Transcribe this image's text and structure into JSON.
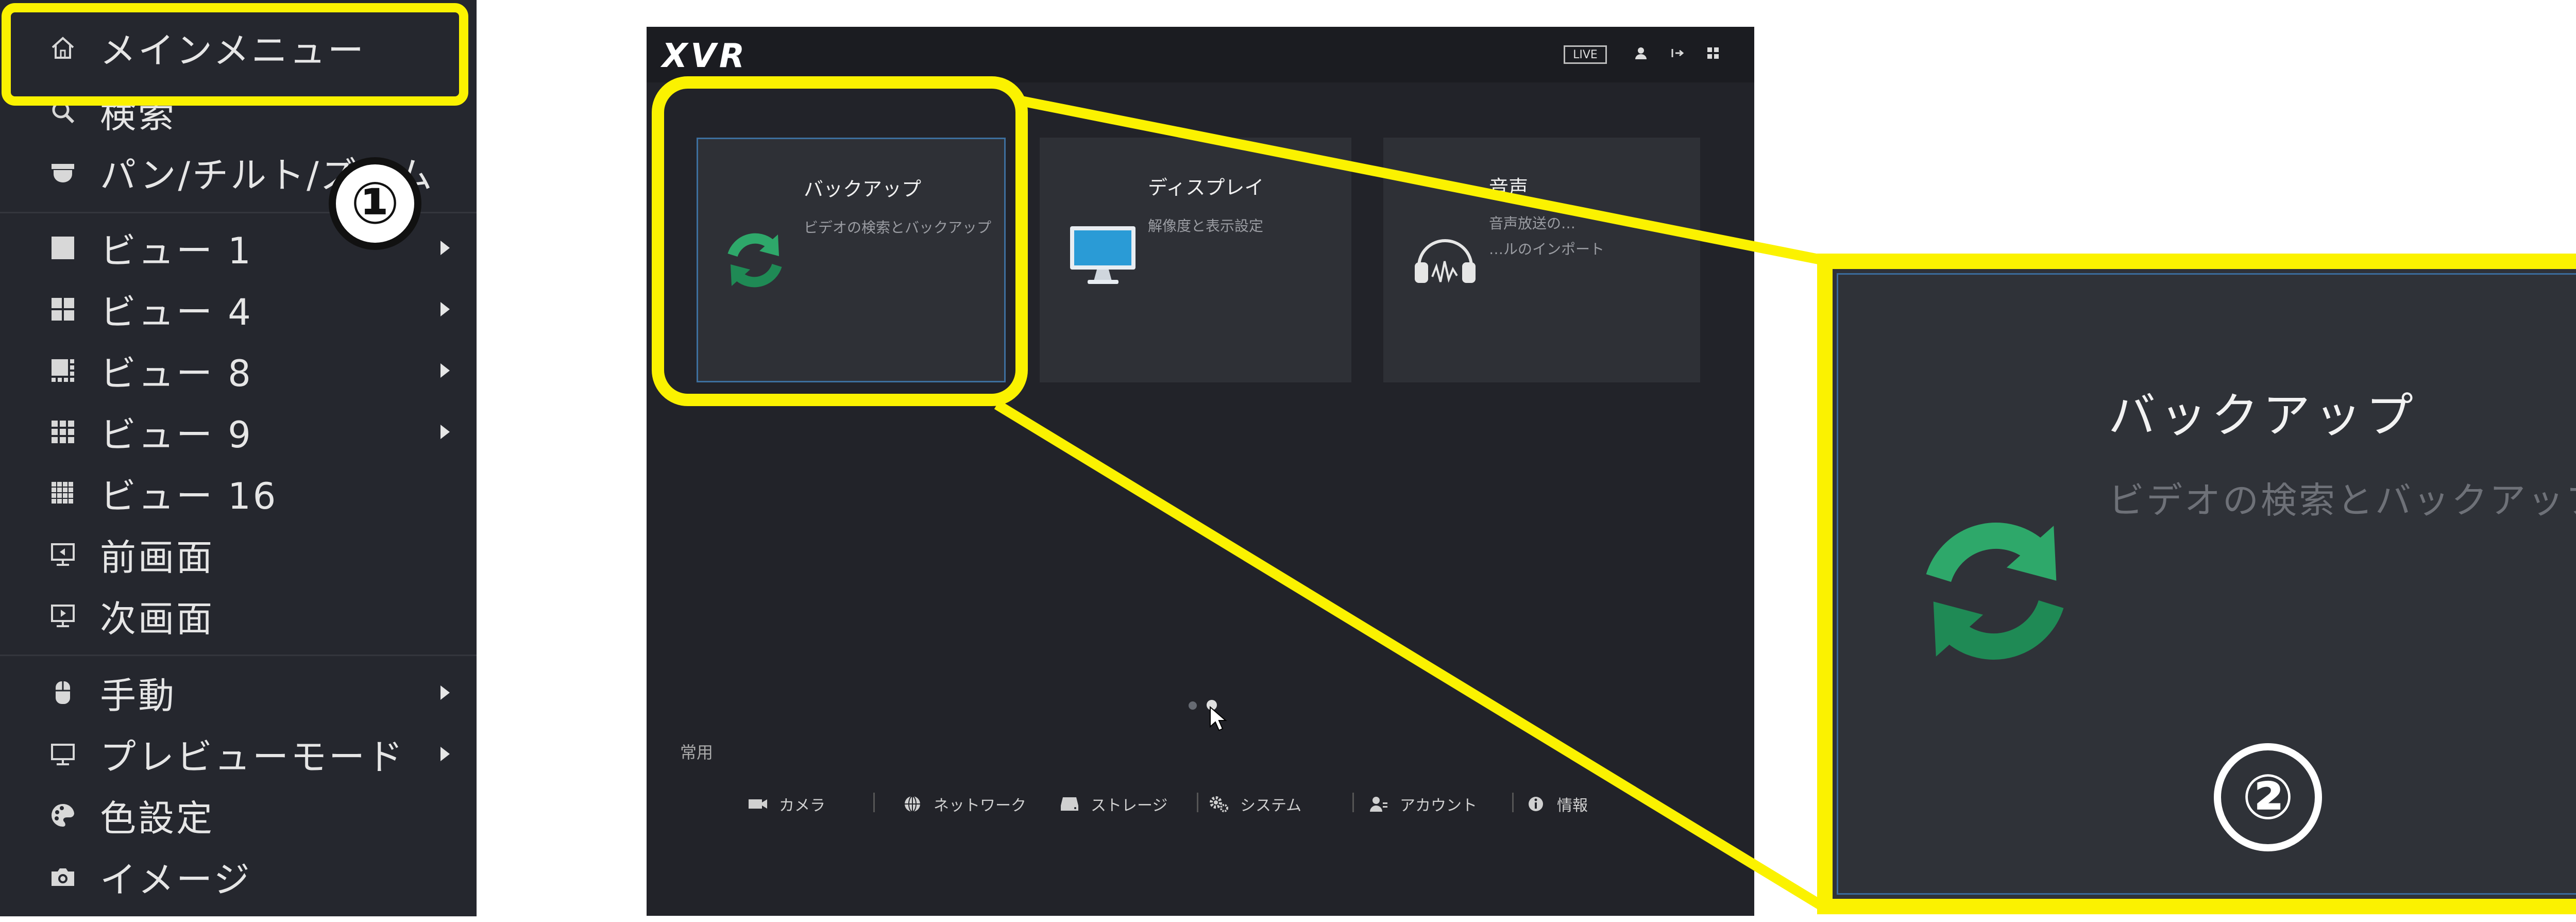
{
  "menu": {
    "items": [
      {
        "label": "メインメニュー",
        "icon": "home-icon",
        "arrow": false
      },
      {
        "label": "検索",
        "icon": "search-icon",
        "arrow": false
      },
      {
        "label": "パン/チルト/ズーム",
        "icon": "ptz-camera-icon",
        "arrow": false
      },
      {
        "label": "ビュー 1",
        "icon": "view-1-icon",
        "arrow": true
      },
      {
        "label": "ビュー 4",
        "icon": "view-4-icon",
        "arrow": true
      },
      {
        "label": "ビュー 8",
        "icon": "view-8-icon",
        "arrow": true
      },
      {
        "label": "ビュー 9",
        "icon": "view-9-icon",
        "arrow": true
      },
      {
        "label": "ビュー 16",
        "icon": "view-16-icon",
        "arrow": false
      },
      {
        "label": "前画面",
        "icon": "previous-screen-icon",
        "arrow": false
      },
      {
        "label": "次画面",
        "icon": "next-screen-icon",
        "arrow": false
      },
      {
        "label": "手動",
        "icon": "manual-icon",
        "arrow": true
      },
      {
        "label": "プレビューモード",
        "icon": "preview-mode-icon",
        "arrow": true
      },
      {
        "label": "色設定",
        "icon": "color-palette-icon",
        "arrow": false
      },
      {
        "label": "イメージ",
        "icon": "camera-icon",
        "arrow": false
      }
    ]
  },
  "badges": {
    "one": "①",
    "two": "②"
  },
  "screen": {
    "logo": "XVR",
    "live": "LIVE",
    "tiles": [
      {
        "title": "バックアップ",
        "desc": "ビデオの検索とバックアップ",
        "icon": "backup-sync-icon"
      },
      {
        "title": "ディスプレイ",
        "desc": "解像度と表示設定",
        "icon": "monitor-icon"
      },
      {
        "title": "音声",
        "desc_line1": "音声放送の…",
        "desc_line2": "…ルのインポート",
        "icon": "headphones-icon"
      }
    ],
    "common_label": "常用",
    "quick_links": [
      {
        "label": "カメラ",
        "icon": "camera-icon"
      },
      {
        "label": "ネットワーク",
        "icon": "network-icon"
      },
      {
        "label": "ストレージ",
        "icon": "storage-icon"
      },
      {
        "label": "システム",
        "icon": "system-gear-icon"
      },
      {
        "label": "アカウント",
        "icon": "account-icon"
      },
      {
        "label": "情報",
        "icon": "info-icon"
      }
    ]
  },
  "zoom": {
    "title": "バックアップ",
    "desc": "ビデオの検索とバックアップ"
  },
  "colors": {
    "highlight": "#fbf200",
    "menu_bg": "#25272e",
    "screen_bg": "#222329",
    "backup_green": "#2ea86a"
  }
}
